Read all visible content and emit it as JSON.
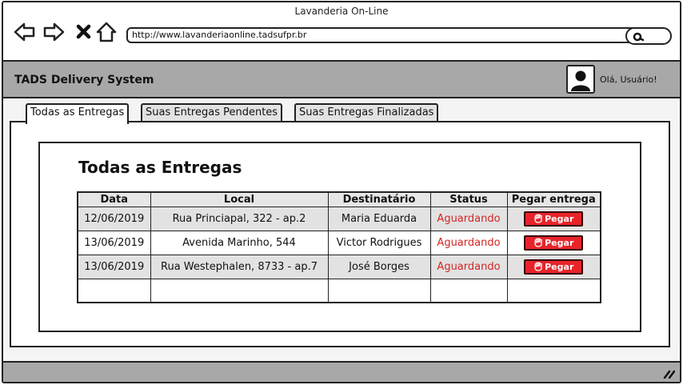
{
  "browser": {
    "window_title": "Lavanderia On-Line",
    "url": "http://www.lavanderiaonline.tadsufpr.br"
  },
  "header": {
    "app_title": "TADS Delivery System",
    "greeting": "Olá, Usuário!"
  },
  "tabs": [
    {
      "label": "Todas as Entregas",
      "active": true
    },
    {
      "label": "Suas Entregas Pendentes",
      "active": false
    },
    {
      "label": "Suas Entregas Finalizadas",
      "active": false
    }
  ],
  "main": {
    "title": "Todas as Entregas",
    "table": {
      "columns": [
        "Data",
        "Local",
        "Destinatário",
        "Status",
        "Pegar entrega"
      ],
      "rows": [
        {
          "data": "12/06/2019",
          "local": "Rua Princiapal, 322 - ap.2",
          "destinatario": "Maria Eduarda",
          "status": "Aguardando",
          "action": "Pegar"
        },
        {
          "data": "13/06/2019",
          "local": "Avenida Marinho, 544",
          "destinatario": "Victor Rodrigues",
          "status": "Aguardando",
          "action": "Pegar"
        },
        {
          "data": "13/06/2019",
          "local": "Rua Westephalen, 8733 - ap.7",
          "destinatario": "José Borges",
          "status": "Aguardando",
          "action": "Pegar"
        }
      ]
    }
  },
  "colors": {
    "status": "#d42525",
    "action_button": "#e8232a",
    "header_bg": "#a8a8a8"
  },
  "icons": {
    "back": "back-arrow-icon",
    "forward": "forward-arrow-icon",
    "stop": "close-icon",
    "home": "home-icon",
    "search": "search-icon",
    "avatar": "user-avatar-icon",
    "action": "hand-icon",
    "resize": "resize-grip-icon"
  }
}
